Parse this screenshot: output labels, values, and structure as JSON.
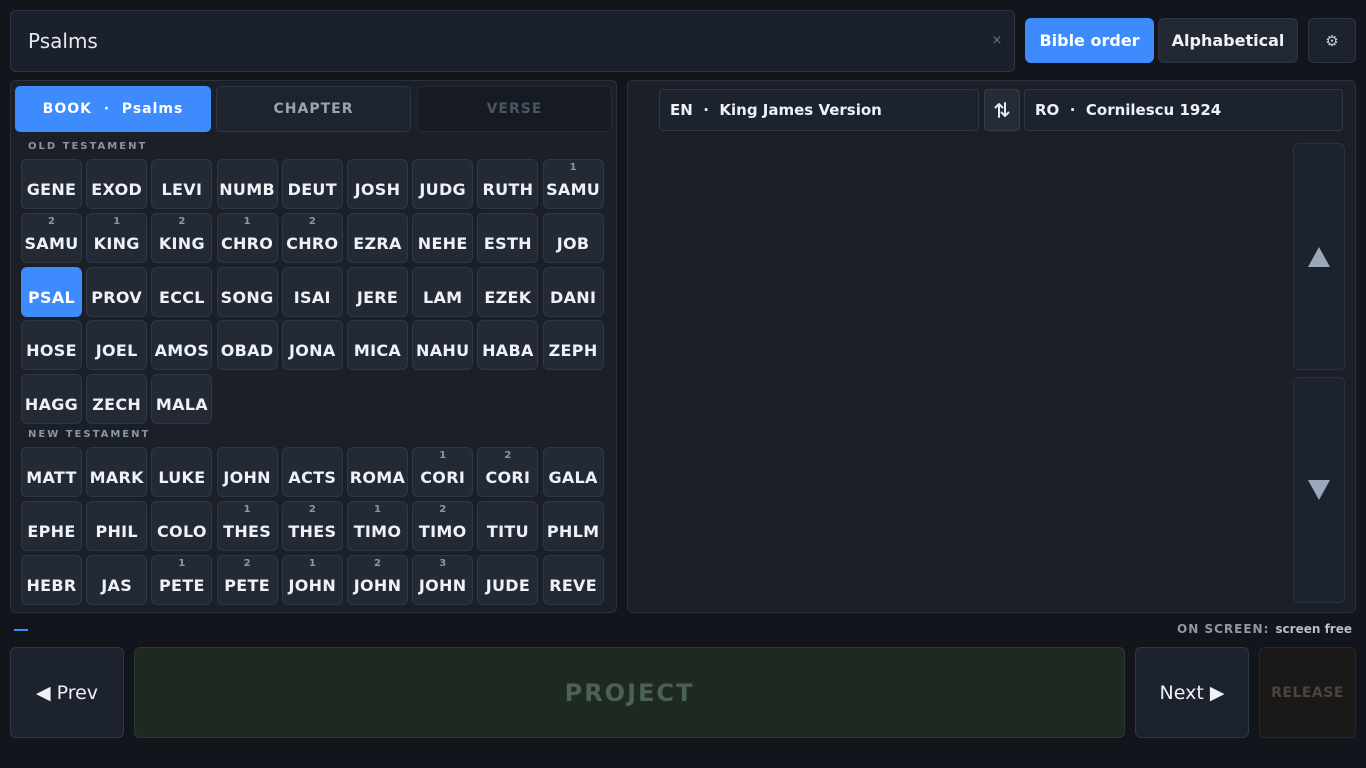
{
  "search": {
    "value": "Psalms",
    "clear_icon": "×"
  },
  "order": {
    "bible_label": "Bible order",
    "alpha_label": "Alphabetical",
    "active": "bible"
  },
  "settings": {
    "icon": "gear-icon",
    "glyph": "⚙"
  },
  "tabs": {
    "book_label": "BOOK  ·  Psalms",
    "chapter_label": "CHAPTER",
    "verse_label": "VERSE"
  },
  "sections": {
    "old": "OLD TESTAMENT",
    "new": "NEW TESTAMENT"
  },
  "old_testament": [
    {
      "num": "",
      "name": "GENE"
    },
    {
      "num": "",
      "name": "EXOD"
    },
    {
      "num": "",
      "name": "LEVI"
    },
    {
      "num": "",
      "name": "NUMB"
    },
    {
      "num": "",
      "name": "DEUT"
    },
    {
      "num": "",
      "name": "JOSH"
    },
    {
      "num": "",
      "name": "JUDG"
    },
    {
      "num": "",
      "name": "RUTH"
    },
    {
      "num": "1",
      "name": "SAMU"
    },
    {
      "num": "2",
      "name": "SAMU"
    },
    {
      "num": "1",
      "name": "KING"
    },
    {
      "num": "2",
      "name": "KING"
    },
    {
      "num": "1",
      "name": "CHRO"
    },
    {
      "num": "2",
      "name": "CHRO"
    },
    {
      "num": "",
      "name": "EZRA"
    },
    {
      "num": "",
      "name": "NEHE"
    },
    {
      "num": "",
      "name": "ESTH"
    },
    {
      "num": "",
      "name": "JOB"
    },
    {
      "num": "",
      "name": "PSAL",
      "active": true
    },
    {
      "num": "",
      "name": "PROV"
    },
    {
      "num": "",
      "name": "ECCL"
    },
    {
      "num": "",
      "name": "SONG"
    },
    {
      "num": "",
      "name": "ISAI"
    },
    {
      "num": "",
      "name": "JERE"
    },
    {
      "num": "",
      "name": "LAM"
    },
    {
      "num": "",
      "name": "EZEK"
    },
    {
      "num": "",
      "name": "DANI"
    },
    {
      "num": "",
      "name": "HOSE"
    },
    {
      "num": "",
      "name": "JOEL"
    },
    {
      "num": "",
      "name": "AMOS"
    },
    {
      "num": "",
      "name": "OBAD"
    },
    {
      "num": "",
      "name": "JONA"
    },
    {
      "num": "",
      "name": "MICA"
    },
    {
      "num": "",
      "name": "NAHU"
    },
    {
      "num": "",
      "name": "HABA"
    },
    {
      "num": "",
      "name": "ZEPH"
    },
    {
      "num": "",
      "name": "HAGG"
    },
    {
      "num": "",
      "name": "ZECH"
    },
    {
      "num": "",
      "name": "MALA"
    }
  ],
  "new_testament": [
    {
      "num": "",
      "name": "MATT"
    },
    {
      "num": "",
      "name": "MARK"
    },
    {
      "num": "",
      "name": "LUKE"
    },
    {
      "num": "",
      "name": "JOHN"
    },
    {
      "num": "",
      "name": "ACTS"
    },
    {
      "num": "",
      "name": "ROMA"
    },
    {
      "num": "1",
      "name": "CORI"
    },
    {
      "num": "2",
      "name": "CORI"
    },
    {
      "num": "",
      "name": "GALA"
    },
    {
      "num": "",
      "name": "EPHE"
    },
    {
      "num": "",
      "name": "PHIL"
    },
    {
      "num": "",
      "name": "COLO"
    },
    {
      "num": "1",
      "name": "THES"
    },
    {
      "num": "2",
      "name": "THES"
    },
    {
      "num": "1",
      "name": "TIMO"
    },
    {
      "num": "2",
      "name": "TIMO"
    },
    {
      "num": "",
      "name": "TITU"
    },
    {
      "num": "",
      "name": "PHLM"
    },
    {
      "num": "",
      "name": "HEBR"
    },
    {
      "num": "",
      "name": "JAS"
    },
    {
      "num": "1",
      "name": "PETE"
    },
    {
      "num": "2",
      "name": "PETE"
    },
    {
      "num": "1",
      "name": "JOHN"
    },
    {
      "num": "2",
      "name": "JOHN"
    },
    {
      "num": "3",
      "name": "JOHN"
    },
    {
      "num": "",
      "name": "JUDE"
    },
    {
      "num": "",
      "name": "REVE"
    }
  ],
  "versions": {
    "left": "EN  ·  King James Version",
    "right": "RO  ·  Cornilescu 1924",
    "swap_icon": "swap-vertical-icon"
  },
  "status": {
    "label": "ON SCREEN:",
    "value": "screen free"
  },
  "buttons": {
    "prev": "◀ Prev",
    "project": "PROJECT",
    "next": "Next ▶",
    "release": "RELEASE"
  },
  "colors": {
    "accent": "#3d8bfd",
    "background": "#12151c",
    "panel": "#1a1f28",
    "project_bg": "#1e2921"
  }
}
